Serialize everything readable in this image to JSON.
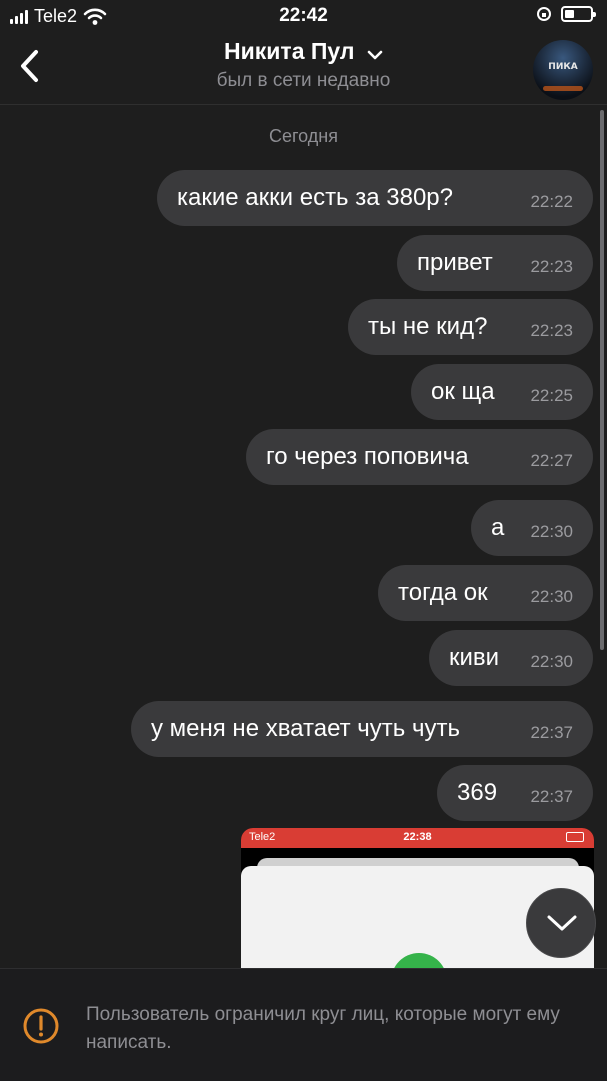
{
  "status_bar": {
    "carrier": "Tele2",
    "time": "22:42",
    "icons": [
      "signal-icon",
      "wifi-icon",
      "rotation-lock-icon",
      "battery-icon"
    ]
  },
  "header": {
    "contact_name": "Никита Пул",
    "subtitle": "был в сети недавно",
    "avatar_caption": "ПИКА",
    "icons": [
      "back-chevron-icon",
      "chevron-down-icon"
    ]
  },
  "chat": {
    "date_separator": "Сегодня",
    "messages": [
      {
        "text": "какие акки есть за 380р?",
        "time": "22:22"
      },
      {
        "text": "привет",
        "time": "22:23"
      },
      {
        "text": "ты не кид?",
        "time": "22:23"
      },
      {
        "text": "ок ща",
        "time": "22:25"
      },
      {
        "text": "го через поповича",
        "time": "22:27"
      },
      {
        "text": "а",
        "time": "22:30"
      },
      {
        "text": "тогда ок",
        "time": "22:30"
      },
      {
        "text": "киви",
        "time": "22:30"
      },
      {
        "text": "у меня не хватает чуть чуть",
        "time": "22:37"
      },
      {
        "text": "369",
        "time": "22:37"
      }
    ],
    "attachment": {
      "carrier": "Tele2",
      "time": "22:38",
      "status_color": "#d93d34"
    }
  },
  "footer": {
    "notice": "Пользователь ограничил круг лиц, которые могут ему написать.",
    "icon": "warning-icon",
    "accent": "#e0892b"
  },
  "colors": {
    "background": "#1e1e1e",
    "bubble": "#3a3a3c",
    "secondary_text": "#8e8e93"
  }
}
